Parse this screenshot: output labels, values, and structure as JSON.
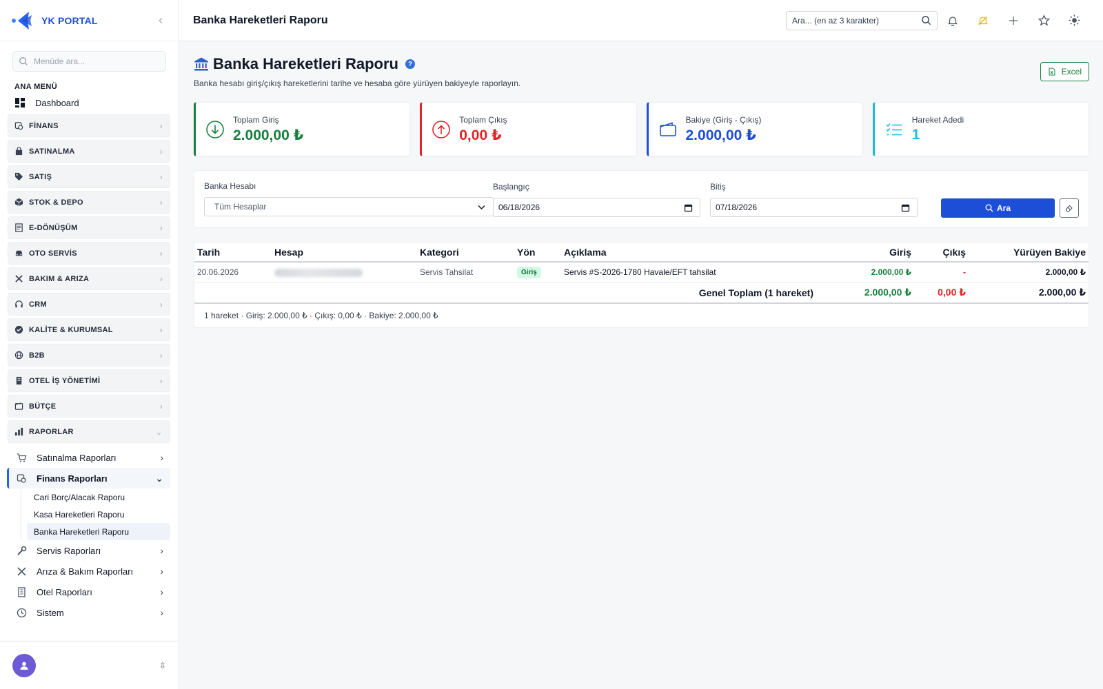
{
  "brand": {
    "name": "YK PORTAL"
  },
  "menu_search": {
    "placeholder": "Menüde ara..."
  },
  "menu_section": "ANA MENÜ",
  "dashboard": "Dashboard",
  "groups": [
    {
      "label": "FİNANS",
      "icon": "finance-icon"
    },
    {
      "label": "SATINALMA",
      "icon": "bag-icon"
    },
    {
      "label": "SATIŞ",
      "icon": "tag-icon"
    },
    {
      "label": "STOK & DEPO",
      "icon": "box-icon"
    },
    {
      "label": "E-DÖNÜŞÜM",
      "icon": "document-icon"
    },
    {
      "label": "OTO SERVİS",
      "icon": "car-icon"
    },
    {
      "label": "BAKIM & ARIZA",
      "icon": "tools-icon"
    },
    {
      "label": "CRM",
      "icon": "headset-icon"
    },
    {
      "label": "KALİTE & KURUMSAL",
      "icon": "badge-check-icon"
    },
    {
      "label": "B2B",
      "icon": "globe-icon"
    },
    {
      "label": "OTEL İŞ YÖNETİMİ",
      "icon": "building-icon"
    },
    {
      "label": "BÜTÇE",
      "icon": "wallet-icon"
    },
    {
      "label": "RAPORLAR",
      "icon": "bar-chart-icon"
    }
  ],
  "report_items": {
    "satinalma": "Satınalma Raporları",
    "finans": "Finans Raporları",
    "finans_leaves": [
      "Cari Borç/Alacak Raporu",
      "Kasa Hareketleri Raporu",
      "Banka Hareketleri Raporu"
    ],
    "servis": "Servis Raporları",
    "ariza": "Arıza & Bakım Raporları",
    "otel": "Otel Raporları",
    "sistem": "Sistem"
  },
  "header": {
    "title": "Banka Hareketleri Raporu",
    "search_placeholder": "Ara... (en az 3 karakter)"
  },
  "page": {
    "title": "Banka Hareketleri Raporu",
    "help": "?",
    "description": "Banka hesabı giriş/çıkış hareketlerini tarihe ve hesaba göre yürüyen bakiyeyle raporlayın.",
    "excel_label": "Excel"
  },
  "stats": [
    {
      "label": "Toplam Giriş",
      "value": "2.000,00 ₺",
      "color": "#15803d"
    },
    {
      "label": "Toplam Çıkış",
      "value": "0,00 ₺",
      "color": "#dc2626"
    },
    {
      "label": "Bakiye (Giriş - Çıkış)",
      "value": "2.000,00 ₺",
      "color": "#1d4ed8"
    },
    {
      "label": "Hareket Adedi",
      "value": "1",
      "color": "#22b8e0"
    }
  ],
  "filters": {
    "account_label": "Banka Hesabı",
    "account_value": "Tüm Hesaplar",
    "start_label": "Başlangıç",
    "start_value": "06/18/2026",
    "end_label": "Bitiş",
    "end_value": "07/18/2026",
    "search_button": "Ara"
  },
  "table": {
    "columns": [
      "Tarih",
      "Hesap",
      "Kategori",
      "Yön",
      "Açıklama",
      "Giriş",
      "Çıkış",
      "Yürüyen Bakiye"
    ],
    "rows": [
      {
        "date": "20.06.2026",
        "category": "Servis Tahsilat",
        "direction": "Giriş",
        "description": "Servis #S-2026-1780 Havale/EFT tahsilat",
        "in": "2.000,00 ₺",
        "out": "-",
        "balance": "2.000,00 ₺"
      }
    ],
    "total": {
      "label": "Genel Toplam (1 hareket)",
      "in": "2.000,00 ₺",
      "out": "0,00 ₺",
      "balance": "2.000,00 ₺"
    },
    "footer": "1 hareket · Giriş: 2.000,00 ₺ · Çıkış: 0,00 ₺ · Bakiye: 2.000,00 ₺"
  },
  "colors": {
    "accent": "#1d4ed8",
    "positive": "#15803d",
    "negative": "#dc2626",
    "info": "#22b8e0"
  }
}
